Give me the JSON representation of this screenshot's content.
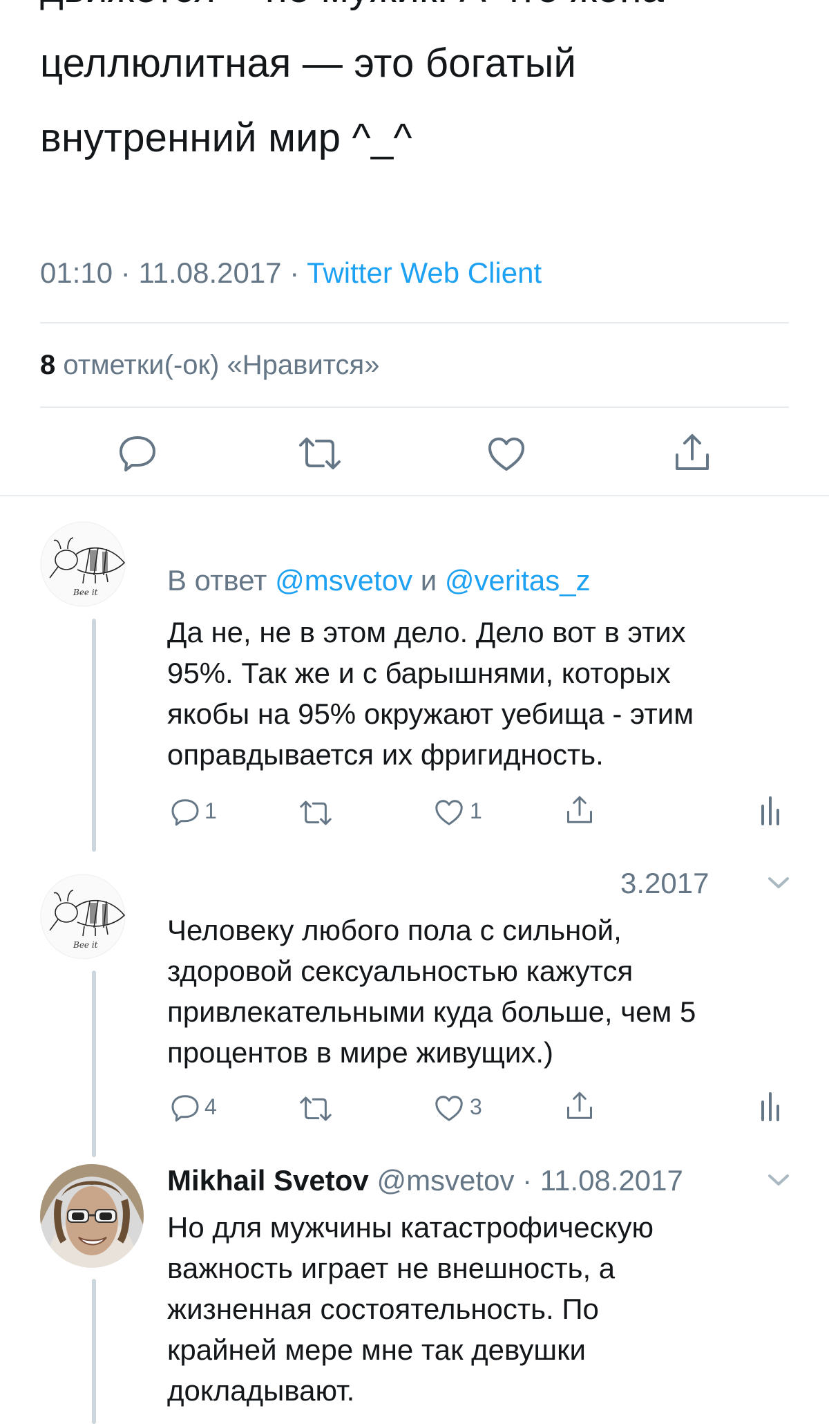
{
  "main_tweet": {
    "text_lines": [
      "",
      "движется -- не мужик. А что жопа",
      "целлюлитная — это богатый",
      "внутренний мир ^_^"
    ],
    "time": "01:10",
    "date": "11.08.2017",
    "separator": "·",
    "source": "Twitter Web Client",
    "likes_count": "8",
    "likes_label": "отметки(-ок) «Нравится»"
  },
  "main_actions": [
    "reply-icon",
    "retweet-icon",
    "like-icon",
    "share-icon"
  ],
  "replies": [
    {
      "reply_prefix": "В ответ",
      "reply_to_1": "@msvetov",
      "reply_joiner": "и",
      "reply_to_2": "@veritas_z",
      "text_lines": [
        "Да не, не в этом дело. Дело вот в этих",
        "95%. Так же и с барышнями, которых",
        "якобы на 95% окружают уебища - этим",
        "оправдывается их фригидность."
      ],
      "reply_count": "1",
      "like_count": "1",
      "avatar_caption": "Bee it"
    },
    {
      "date_partial": "3.2017",
      "text_lines": [
        "Человеку любого пола с сильной,",
        "здоровой сексуальностью кажутся",
        "привлекательными куда больше, чем 5",
        "процентов в мире живущих.)"
      ],
      "reply_count": "4",
      "like_count": "3",
      "avatar_caption": "Bee it"
    },
    {
      "name": "Mikhail Svetov",
      "handle": "@msvetov",
      "separator": "·",
      "date": "11.08.2017",
      "text_lines": [
        "Но для мужчины катастрофическую",
        "важность играет не внешность, а",
        "жизненная состоятельность. По",
        "крайней мере мне так девушки",
        "докладывают."
      ]
    }
  ],
  "colors": {
    "text": "#14171a",
    "secondary": "#657786",
    "accent": "#1da1f2",
    "divider": "#e6ecf0",
    "thread_line": "#ccd6dd"
  }
}
